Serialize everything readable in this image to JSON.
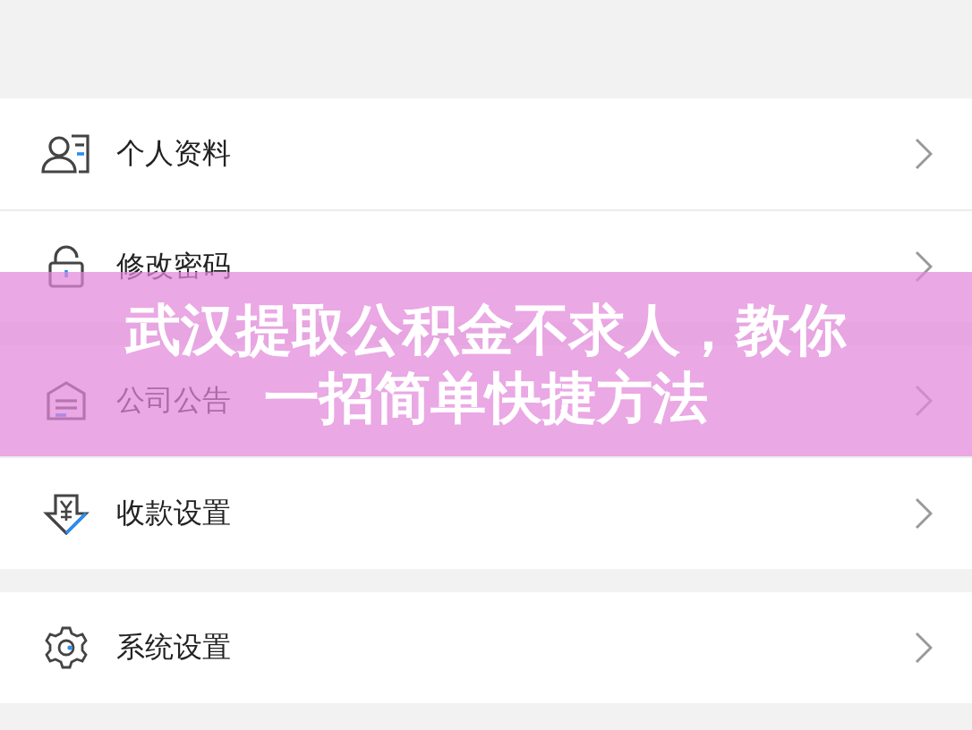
{
  "sections": [
    {
      "items": [
        {
          "kind": "profile",
          "label": "个人资料"
        },
        {
          "kind": "lock",
          "label": "修改密码"
        }
      ]
    },
    {
      "items": [
        {
          "kind": "notice",
          "label": "公司公告"
        },
        {
          "kind": "payment",
          "label": "收款设置"
        }
      ]
    },
    {
      "items": [
        {
          "kind": "gear",
          "label": "系统设置"
        }
      ]
    }
  ],
  "banner": {
    "title_lines": [
      "武汉提取公积金不求人，教你",
      "一招简单快捷方法"
    ]
  }
}
